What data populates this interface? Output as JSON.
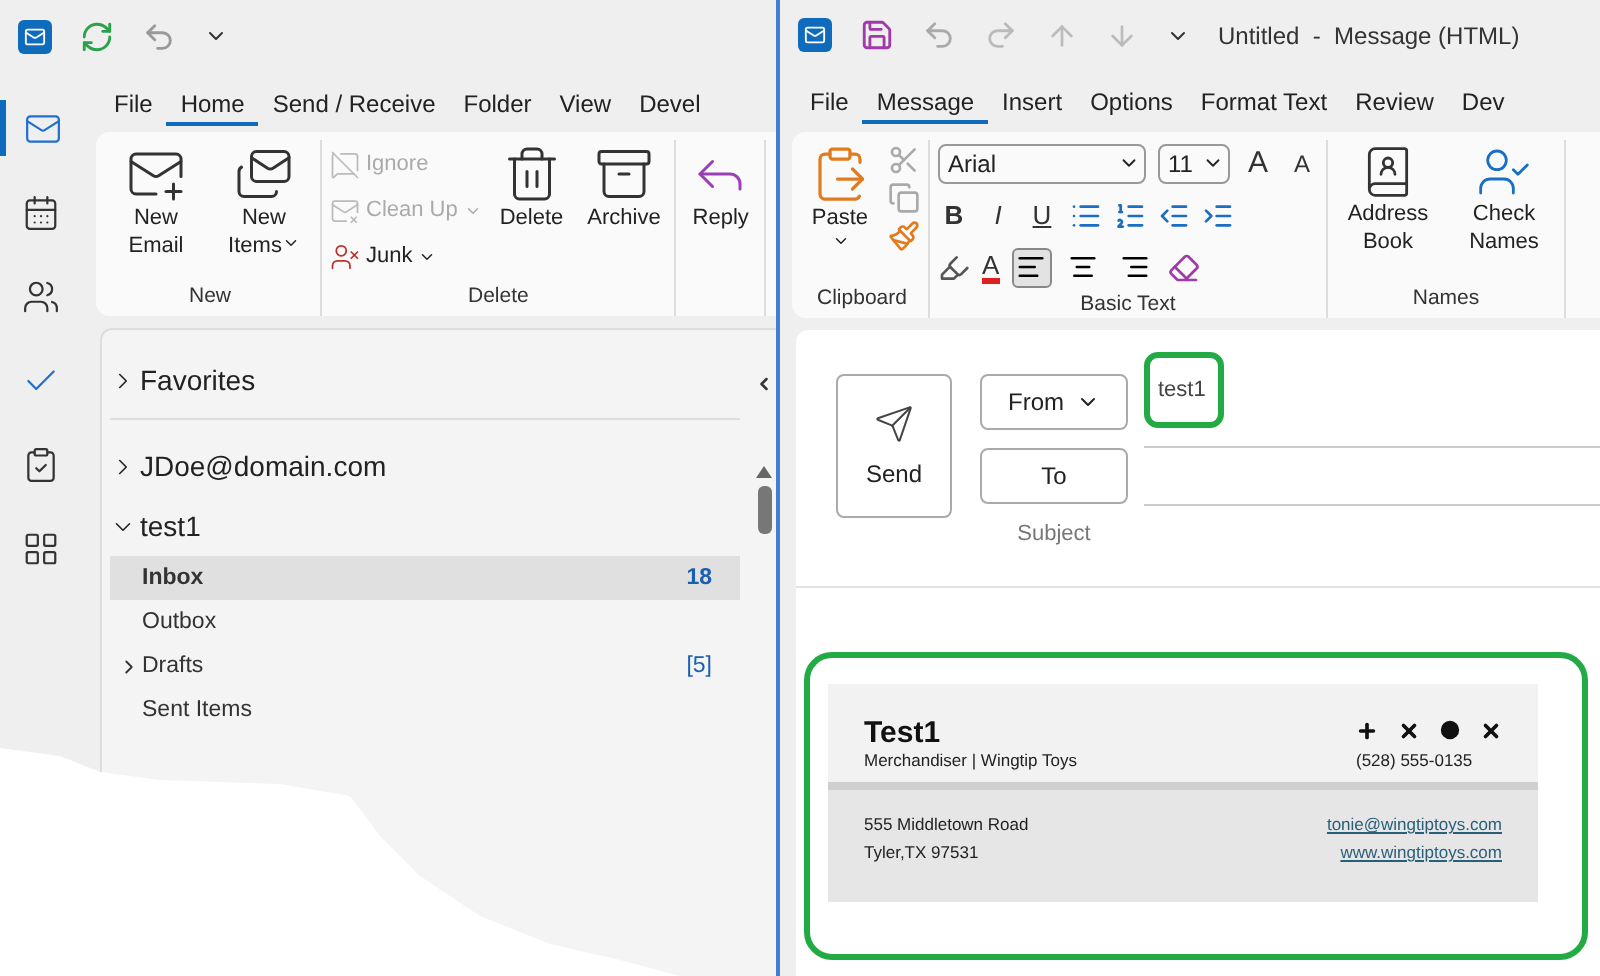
{
  "main_window": {
    "rail": [
      {
        "selected": true
      },
      {
        "selected": false
      },
      {
        "selected": false
      },
      {
        "selected": false
      },
      {
        "selected": false
      },
      {
        "selected": false
      }
    ],
    "tabs": [
      {
        "label": "File",
        "selected": false
      },
      {
        "label": "Home",
        "selected": true
      },
      {
        "label": "Send / Receive",
        "selected": false
      },
      {
        "label": "Folder",
        "selected": false
      },
      {
        "label": "View",
        "selected": false
      },
      {
        "label": "Devel",
        "selected": false
      }
    ],
    "ribbon_groups": [
      {
        "label": "New",
        "items": [
          {
            "label": "New Email",
            "kind": "large",
            "dropdown": false,
            "disabled": false
          },
          {
            "label": "New Items",
            "kind": "large",
            "dropdown": true,
            "disabled": false
          }
        ]
      },
      {
        "label": "Delete",
        "items": [
          {
            "label": "Ignore",
            "kind": "small",
            "dropdown": false,
            "disabled": true
          },
          {
            "label": "Clean Up",
            "kind": "small",
            "dropdown": true,
            "disabled": true
          },
          {
            "label": "Junk",
            "kind": "small",
            "dropdown": true,
            "disabled": false
          },
          {
            "label": "Delete",
            "kind": "large",
            "dropdown": false,
            "disabled": false
          },
          {
            "label": "Archive",
            "kind": "large",
            "dropdown": false,
            "disabled": false
          }
        ]
      },
      {
        "items": [
          {
            "label": "Reply",
            "kind": "large",
            "dropdown": false,
            "disabled": false
          }
        ]
      }
    ],
    "folders": [
      {
        "label": "Favorites",
        "expanded": false
      },
      {
        "label": "JDoe@domain.com",
        "expanded": false
      },
      {
        "label": "test1",
        "expanded": true,
        "children": [
          {
            "label": "Inbox",
            "selected": true,
            "unread": true,
            "count": "18",
            "expandable": false
          },
          {
            "label": "Outbox",
            "selected": false,
            "unread": false,
            "expandable": false
          },
          {
            "label": "Drafts",
            "selected": false,
            "unread": false,
            "count": "[5]",
            "expandable": true
          },
          {
            "label": "Sent Items",
            "selected": false,
            "unread": false,
            "expandable": false
          }
        ]
      }
    ]
  },
  "message_window": {
    "title": "Untitled  -  Message (HTML)",
    "tabs": [
      {
        "label": "File",
        "selected": false
      },
      {
        "label": "Message",
        "selected": true
      },
      {
        "label": "Insert",
        "selected": false
      },
      {
        "label": "Options",
        "selected": false
      },
      {
        "label": "Format Text",
        "selected": false
      },
      {
        "label": "Review",
        "selected": false
      },
      {
        "label": "Dev",
        "selected": false
      }
    ],
    "clipboard": {
      "label": "Clipboard",
      "paste": "Paste"
    },
    "basic_text": {
      "label": "Basic Text",
      "font": "Arial",
      "size": "11",
      "size_buttons": [
        {
          "label": "A",
          "kind": "grow"
        },
        {
          "label": "A",
          "kind": "shrink"
        }
      ],
      "style_buttons": [
        {
          "label": "B",
          "kind": "bold"
        },
        {
          "label": "I",
          "kind": "italic"
        },
        {
          "label": "U",
          "kind": "underline"
        }
      ],
      "font_color": "A",
      "alignment": [
        {
          "selected": true
        },
        {
          "selected": false
        },
        {
          "selected": false
        }
      ]
    },
    "names": {
      "label": "Names",
      "buttons": [
        "Address Book",
        "Check Names"
      ]
    },
    "compose": {
      "send": "Send",
      "from_button": "From",
      "from_value": "test1",
      "to_button": "To",
      "subject_label": "Subject"
    },
    "signature": {
      "name": "Test1",
      "title": "Merchandiser | Wingtip Toys",
      "phone": "(528) 555-0135",
      "address": [
        "555 Middletown Road",
        "Tyler,TX 97531"
      ],
      "links": [
        "tonie@wingtiptoys.com",
        "www.wingtiptoys.com"
      ]
    }
  }
}
